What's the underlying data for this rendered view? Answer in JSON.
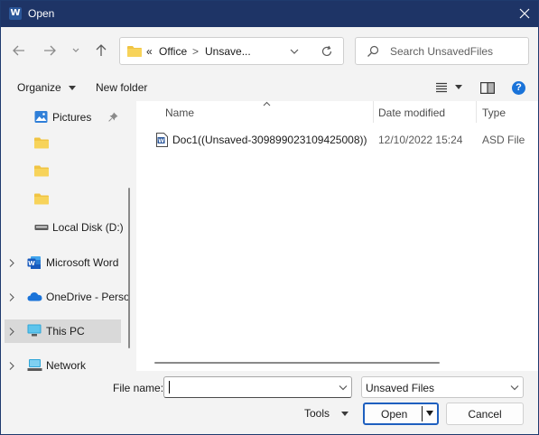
{
  "window": {
    "title": "Open",
    "app_icon_letter": "W",
    "accent": "#1e3466"
  },
  "navbar": {
    "address": {
      "overflow": "«",
      "segment_1": "Office",
      "separator": ">",
      "segment_2": "Unsave..."
    },
    "search": {
      "placeholder": "Search UnsavedFiles"
    }
  },
  "toolbar": {
    "organize_label": "Organize",
    "new_folder_label": "New folder"
  },
  "navpane": {
    "items": [
      {
        "label": "Pictures",
        "icon": "pictures-icon"
      },
      {
        "label": "",
        "icon": "folder-icon"
      },
      {
        "label": "",
        "icon": "folder-icon"
      },
      {
        "label": "",
        "icon": "folder-icon"
      },
      {
        "label": "Local Disk (D:)",
        "icon": "drive-icon"
      },
      {
        "label": "Microsoft Word",
        "icon": "word-icon"
      },
      {
        "label": "OneDrive - Perso",
        "icon": "onedrive-icon"
      },
      {
        "label": "This PC",
        "icon": "this-pc-icon",
        "selected": true
      },
      {
        "label": "Network",
        "icon": "network-icon"
      }
    ]
  },
  "filelist": {
    "columns": [
      "Name",
      "Date modified",
      "Type"
    ],
    "rows": [
      {
        "name": "Doc1((Unsaved-309899023109425008))",
        "date_modified": "12/10/2022 15:24",
        "type": "ASD File"
      }
    ]
  },
  "footer": {
    "file_name_label": "File name:",
    "file_name_value": "",
    "file_type_selected": "Unsaved Files",
    "tools_label": "Tools",
    "open_label": "Open",
    "cancel_label": "Cancel",
    "primary_color": "#1e5fbf"
  }
}
